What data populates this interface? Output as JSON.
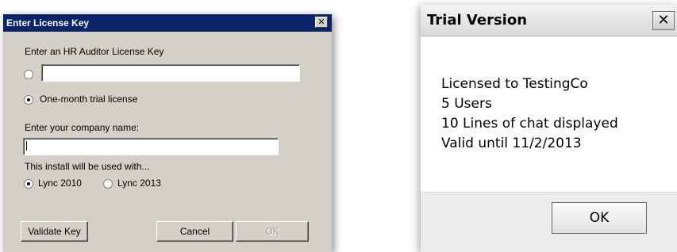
{
  "license_dialog": {
    "title": "Enter License Key",
    "close_glyph": "✕",
    "license_key_prompt": "Enter an HR Auditor License Key",
    "license_key_value": "",
    "license_key_radio_selected": false,
    "trial_option_label": "One-month trial license",
    "trial_option_selected": true,
    "company_prompt": "Enter your company name:",
    "company_value": "",
    "usage_prompt": "This install will be used with...",
    "lync_options": [
      {
        "label": "Lync 2010",
        "selected": true
      },
      {
        "label": "Lync 2013",
        "selected": false
      }
    ],
    "buttons": {
      "validate": "Validate Key",
      "cancel": "Cancel",
      "ok": "OK"
    }
  },
  "trial_dialog": {
    "title": "Trial Version",
    "close_glyph": "✕",
    "lines": [
      "Licensed to TestingCo",
      "5 Users",
      "10 Lines of chat displayed",
      "Valid until 11/2/2013"
    ],
    "ok_label": "OK"
  }
}
